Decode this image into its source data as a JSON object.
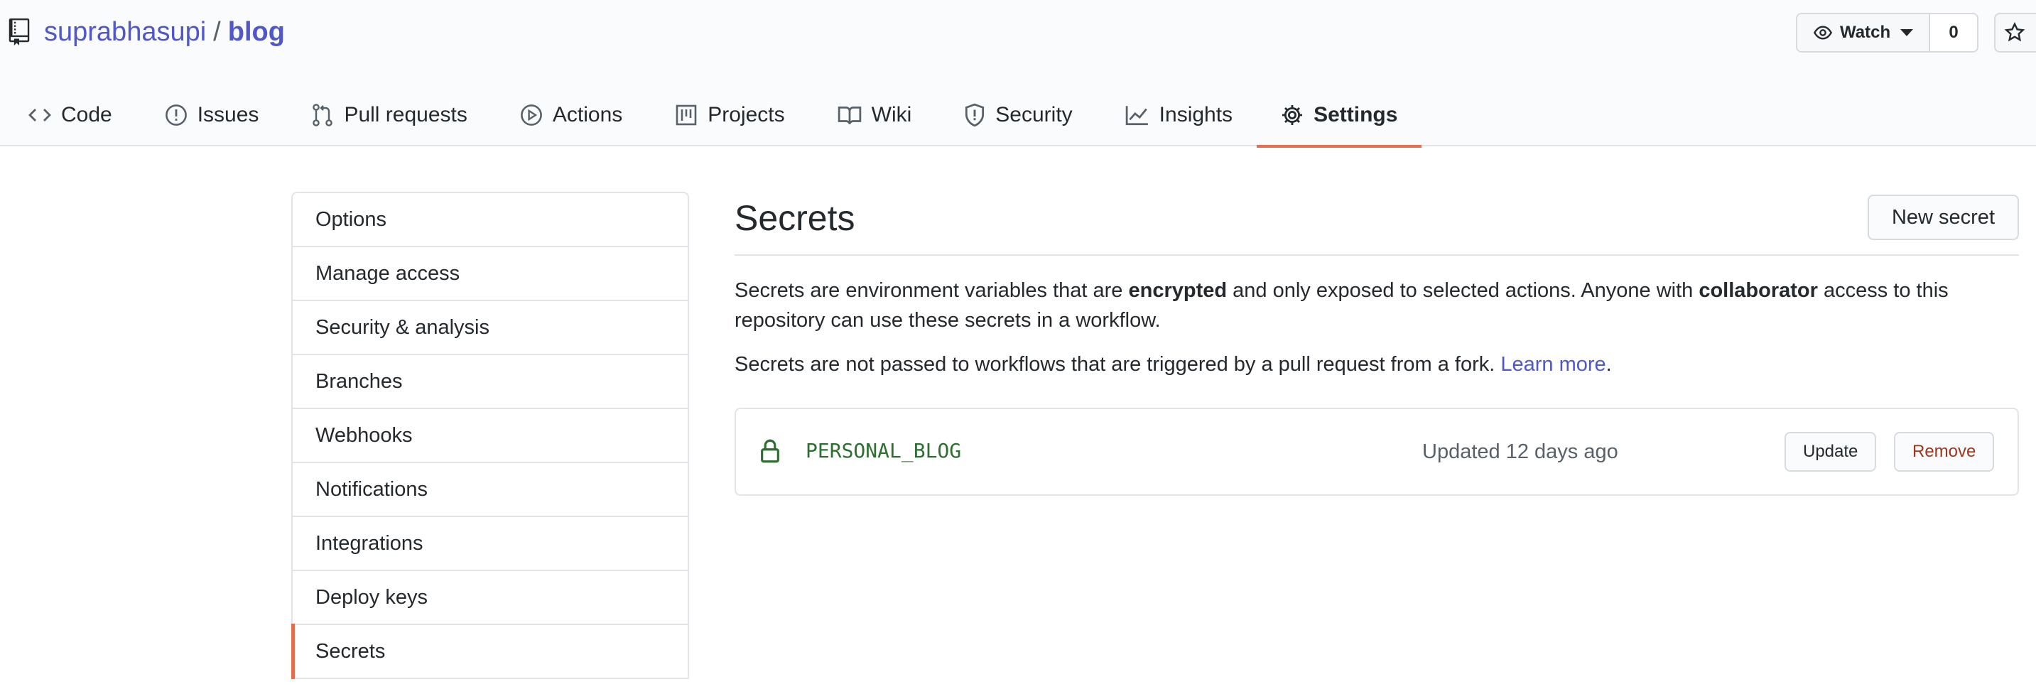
{
  "repo": {
    "owner": "suprabhasupi",
    "separator": "/",
    "name": "blog"
  },
  "actions": {
    "watch_label": "Watch",
    "watch_count": "0"
  },
  "nav": [
    {
      "label": "Code",
      "icon": "code-icon"
    },
    {
      "label": "Issues",
      "icon": "issue-icon"
    },
    {
      "label": "Pull requests",
      "icon": "pull-request-icon"
    },
    {
      "label": "Actions",
      "icon": "play-icon"
    },
    {
      "label": "Projects",
      "icon": "project-icon"
    },
    {
      "label": "Wiki",
      "icon": "book-icon"
    },
    {
      "label": "Security",
      "icon": "shield-icon"
    },
    {
      "label": "Insights",
      "icon": "graph-icon"
    },
    {
      "label": "Settings",
      "icon": "gear-icon",
      "selected": true
    }
  ],
  "sidebar": {
    "items": [
      {
        "label": "Options"
      },
      {
        "label": "Manage access"
      },
      {
        "label": "Security & analysis"
      },
      {
        "label": "Branches"
      },
      {
        "label": "Webhooks"
      },
      {
        "label": "Notifications"
      },
      {
        "label": "Integrations"
      },
      {
        "label": "Deploy keys"
      },
      {
        "label": "Secrets",
        "selected": true
      }
    ]
  },
  "main": {
    "title": "Secrets",
    "new_secret_label": "New secret",
    "desc1": {
      "part1": "Secrets are environment variables that are ",
      "bold1": "encrypted",
      "part2": " and only exposed to selected actions. Anyone with ",
      "bold2": "collaborator",
      "part3": " access to this repository can use these secrets in a workflow."
    },
    "desc2": {
      "text": "Secrets are not passed to workflows that are triggered by a pull request from a fork. ",
      "link": "Learn more",
      "end": "."
    },
    "secrets": [
      {
        "name": "PERSONAL_BLOG",
        "updated": "Updated 12 days ago",
        "update_label": "Update",
        "remove_label": "Remove"
      }
    ]
  },
  "colors": {
    "accent": "#e36d4c",
    "link": "#4f57c9",
    "secret_name": "#2c6f31",
    "remove": "#a0351b"
  }
}
